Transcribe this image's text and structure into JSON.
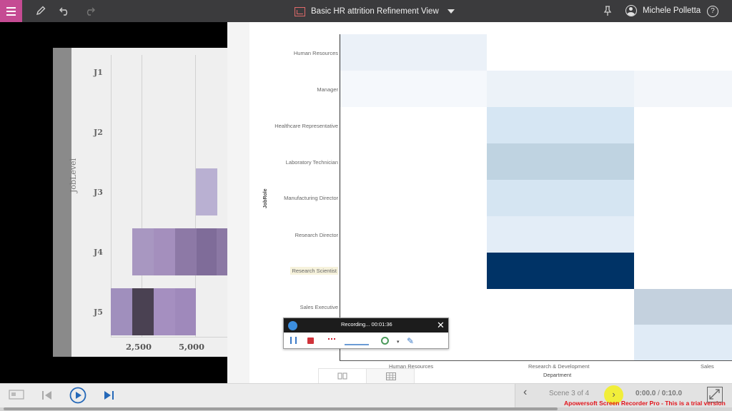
{
  "topbar": {
    "report_title": "Basic HR attrition Refinement View",
    "user_name": "Michele Polletta",
    "help_label": "?",
    "icons": [
      "menu-icon",
      "pencil-icon",
      "undo-icon",
      "redo-icon",
      "report-icon",
      "pin-icon",
      "user-icon",
      "help-icon"
    ]
  },
  "left_chart": {
    "axis_label": "JobLevel",
    "levels": [
      "J1",
      "J2",
      "J3",
      "J4",
      "J5"
    ],
    "ticks": [
      "2,500",
      "5,000"
    ]
  },
  "heatmap": {
    "y_label": "JobRole",
    "x_label": "Department",
    "roles": [
      "Human Resources",
      "Manager",
      "Healthcare Representative",
      "Laboratory Technician",
      "Manufacturing Director",
      "Research Director",
      "Research Scientist",
      "Sales Executive"
    ],
    "highlighted_role": "Research Scientist",
    "departments": [
      "Human Resources",
      "Research & Development",
      "Sales"
    ]
  },
  "recorder": {
    "status": "Recording... 00:01:36",
    "close": "✕",
    "caret": "▾",
    "pen": "✎"
  },
  "view_tabs": {
    "tab1_icon": "book-icon",
    "tab2_icon": "table-icon"
  },
  "bottombar": {
    "scene": "Scene 3 of 4",
    "time_current": "0:00.0",
    "time_sep": "/",
    "time_total": "0:10.0",
    "prev_symbol": "‹",
    "next_symbol": "›",
    "watermark": "Apowersoft Screen Recorder Pro - This is a trial version"
  },
  "colors": {
    "accent": "#c54b93",
    "topbar": "#3b3b3d",
    "heat_max": "#003366",
    "next_highlight": "#f1ee3a"
  }
}
